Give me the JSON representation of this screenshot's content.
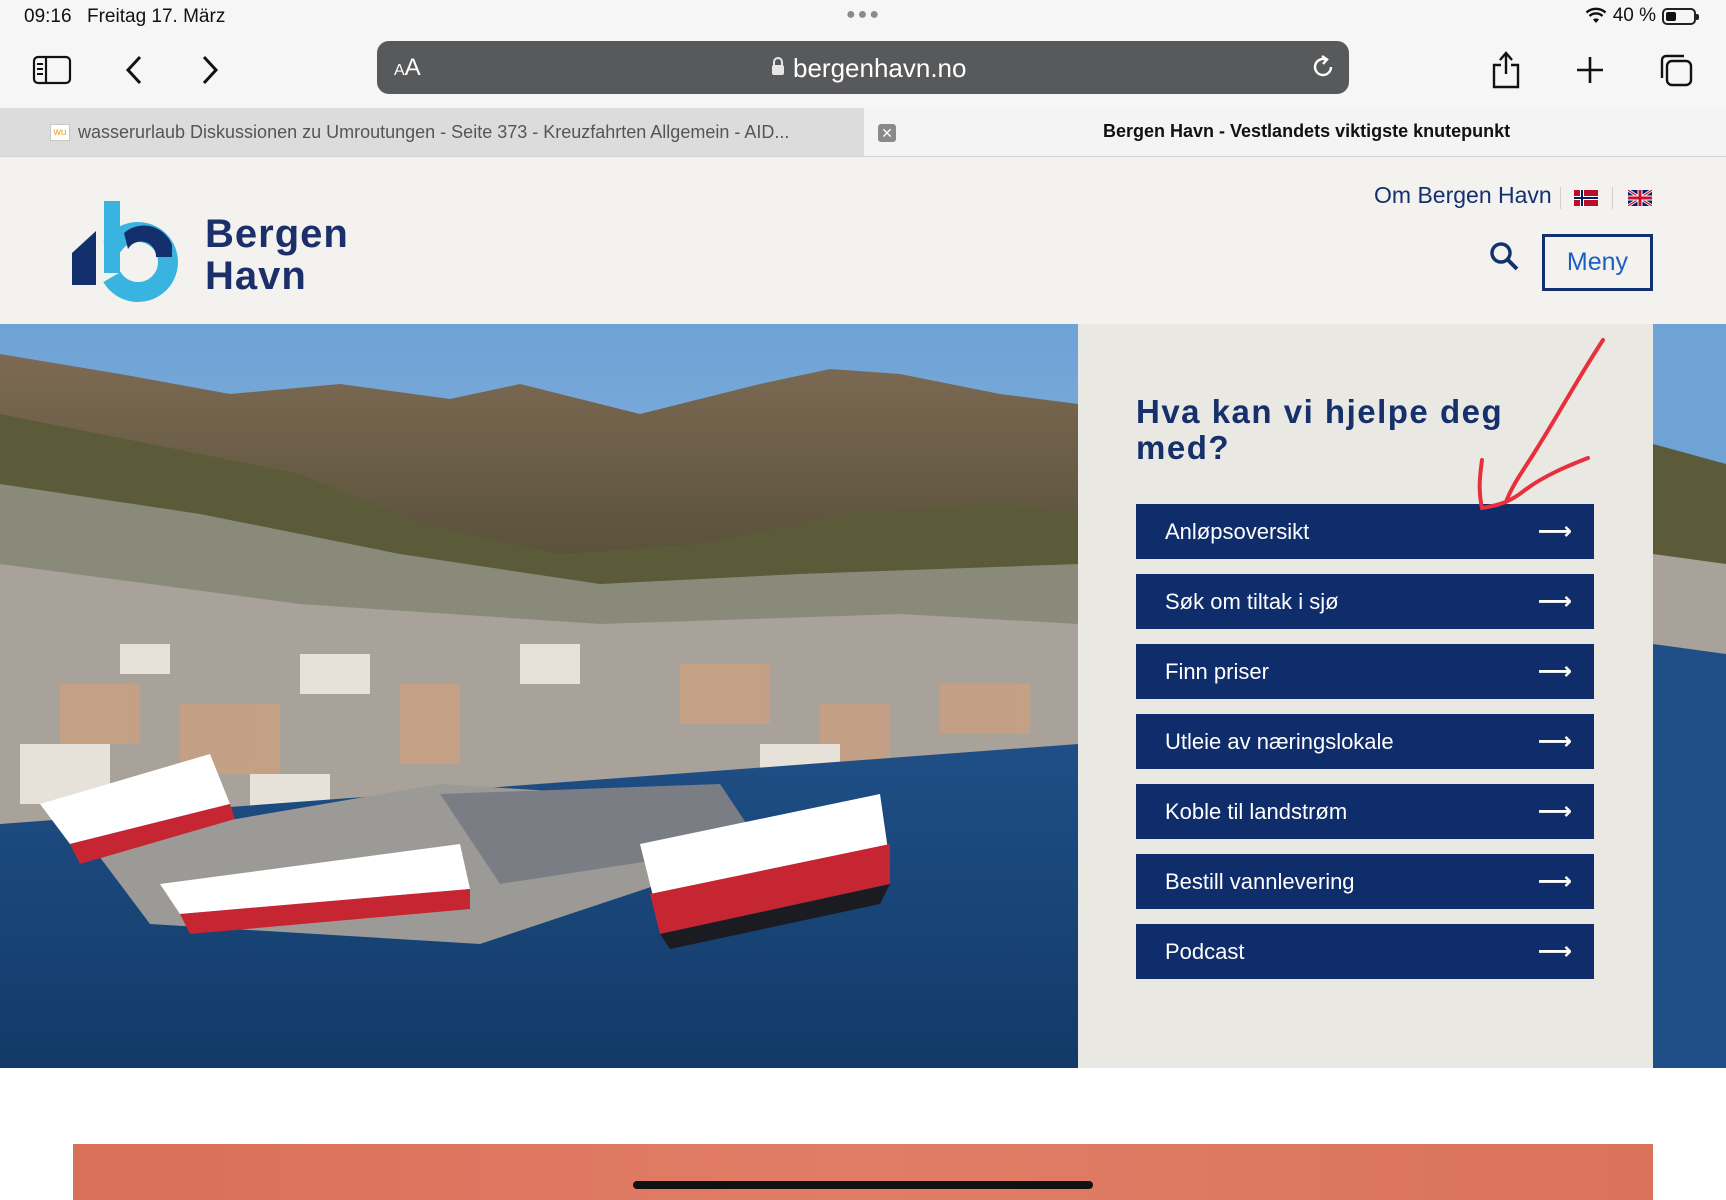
{
  "status_bar": {
    "time": "09:16",
    "date": "Freitag 17. März",
    "battery": "40 %",
    "battery_level": 0.4
  },
  "toolbar": {
    "url_text_size": "AA",
    "url": "bergenhavn.no",
    "icons": [
      "sidebar-icon",
      "back-icon",
      "forward-icon",
      "share-icon",
      "new-tab-icon",
      "tabs-overview-icon"
    ]
  },
  "tabs": [
    {
      "title": "wasserurlaub Diskussionen zu Umroutungen - Seite 373 - Kreuzfahrten Allgemein - AID...",
      "favicon": "wu",
      "active": false
    },
    {
      "title": "Bergen Havn - Vestlandets viktigste knutepunkt",
      "active": true
    }
  ],
  "site": {
    "logo_line1": "Bergen",
    "logo_line2": "Havn",
    "nav_link": "Om Bergen Havn",
    "menu_label": "Meny",
    "brand_color": "#0f2d6b",
    "accent_color": "#36b4e0"
  },
  "help": {
    "title": "Hva kan vi hjelpe deg med?",
    "items": [
      {
        "label": "Anløpsoversikt"
      },
      {
        "label": "Søk om tiltak i sjø"
      },
      {
        "label": "Finn priser"
      },
      {
        "label": "Utleie av næringslokale"
      },
      {
        "label": "Koble til landstrøm"
      },
      {
        "label": "Bestill vannlevering"
      },
      {
        "label": "Podcast"
      }
    ]
  }
}
